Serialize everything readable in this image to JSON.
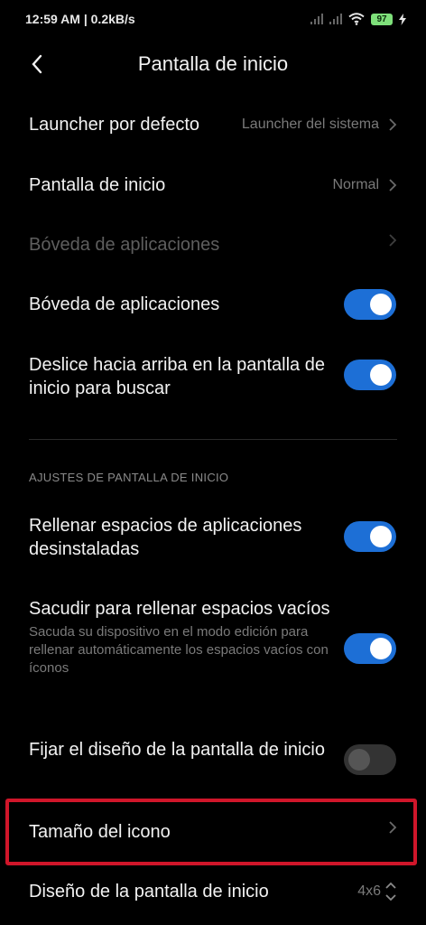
{
  "status": {
    "time_speed": "12:59 AM | 0.2kB/s",
    "battery": "97"
  },
  "header": {
    "title": "Pantalla de inicio"
  },
  "rows": {
    "launcher": {
      "label": "Launcher por defecto",
      "value": "Launcher del sistema"
    },
    "home": {
      "label": "Pantalla de inicio",
      "value": "Normal"
    },
    "vault_disabled": {
      "label": "Bóveda de aplicaciones"
    },
    "vault": {
      "label": "Bóveda de aplicaciones",
      "on": true
    },
    "swipe": {
      "label": "Deslice hacia arriba en la pantalla de inicio para buscar",
      "on": true
    }
  },
  "section": {
    "title": "AJUSTES DE PANTALLA DE INICIO"
  },
  "settings": {
    "fill": {
      "label": "Rellenar espacios de aplicaciones desinstaladas",
      "on": true
    },
    "shake": {
      "label": "Sacudir para rellenar espacios vacíos",
      "desc": "Sacuda su dispositivo en el modo edición para rellenar automáticamente los espacios vacíos con íconos",
      "on": true
    },
    "lock": {
      "label": "Fijar el diseño de la pantalla de inicio",
      "on": false
    },
    "icon_size": {
      "label": "Tamaño del icono"
    },
    "layout": {
      "label": "Diseño de la pantalla de inicio",
      "value": "4x6"
    }
  },
  "colors": {
    "accent": "#1d6fd6",
    "highlight": "#d0162a"
  }
}
